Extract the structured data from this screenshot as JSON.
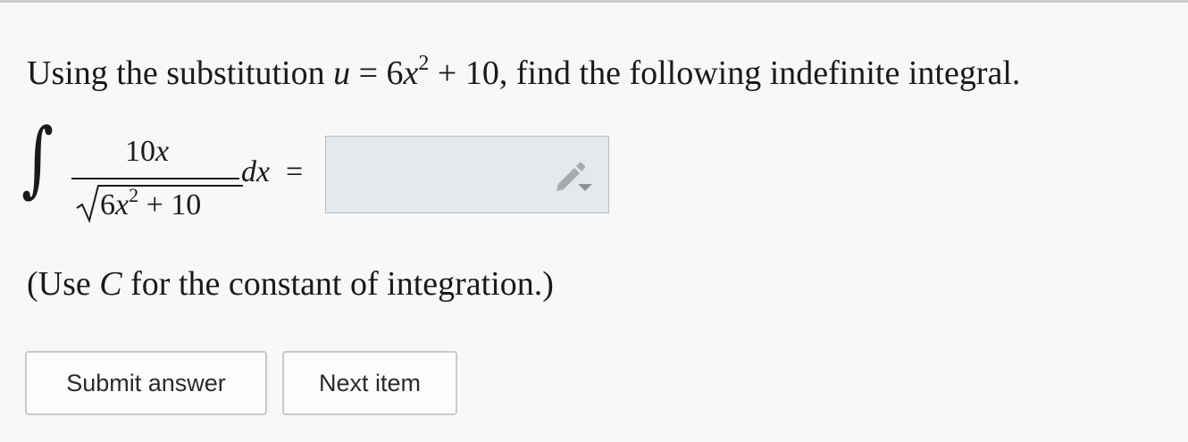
{
  "question": {
    "prefix": "Using the substitution ",
    "var_u": "u",
    "equals": " = 6",
    "var_x": "x",
    "exponent": "2",
    "suffix": " + 10, find the following indefinite integral."
  },
  "integral": {
    "sign": "∫",
    "numerator_coef": "10",
    "numerator_var": "x",
    "denominator_coef": "6",
    "denominator_var": "x",
    "denominator_exp": "2",
    "denominator_rest": " + 10",
    "differential": "dx",
    "equals": "="
  },
  "answer_input": {
    "value": "",
    "icon": "pencil-dropdown-icon"
  },
  "note": {
    "open": "(Use ",
    "constant": "C",
    "close": " for the constant of integration.)"
  },
  "buttons": {
    "submit_label": "Submit answer",
    "next_label": "Next item"
  }
}
